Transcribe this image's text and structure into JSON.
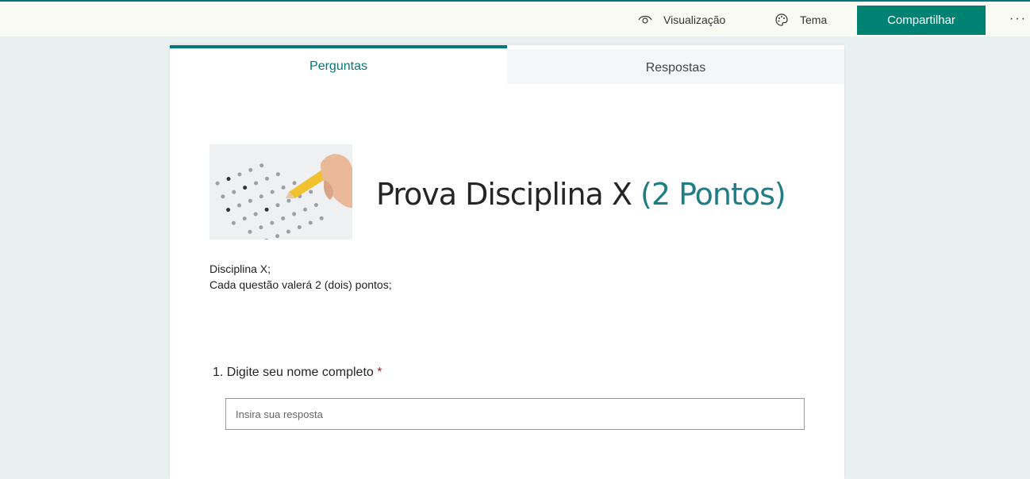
{
  "topbar": {
    "preview_label": "Visualização",
    "theme_label": "Tema",
    "share_label": "Compartilhar",
    "more_label": "···"
  },
  "tabs": [
    {
      "label": "Perguntas"
    },
    {
      "label": "Respostas"
    }
  ],
  "form": {
    "title": "Prova Disciplina X",
    "points": "(2 Pontos)",
    "description": [
      "Disciplina X;",
      "Cada questão valerá 2 (dois) pontos;"
    ]
  },
  "question": {
    "number": "1.",
    "text": "Digite seu nome completo",
    "required_mark": "*",
    "placeholder": "Insira sua resposta"
  },
  "colors": {
    "accent": "#03787c",
    "share_button": "#008272",
    "required": "#a4262c"
  }
}
